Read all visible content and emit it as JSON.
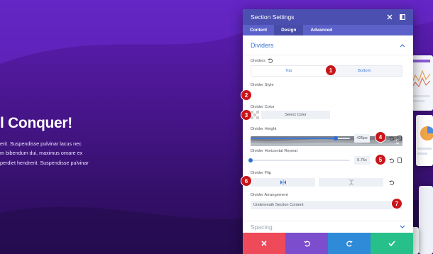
{
  "hero": {
    "title": "l Conquer!",
    "lines": [
      "erit. Suspendisse pulvinar lacus nec",
      "m bibendum dui, maximus ornare ex",
      "perdiet hendrerit. Suspendisse pulvinar"
    ]
  },
  "modal": {
    "title": "Section Settings",
    "tabs": [
      "Content",
      "Design",
      "Advanced"
    ],
    "active_tab": "Design",
    "section_title": "Dividers",
    "dividers_label": "Dividers",
    "segments": [
      "Top",
      "Bottom"
    ],
    "style_label": "Divider Style",
    "color_label": "Divider Color",
    "select_color": "Select Color",
    "height_label": "Divider Height",
    "height_value": "425px",
    "height_fraction": 0.86,
    "repeat_label": "Divider Horizontal Repeat",
    "repeat_value": "0.75x",
    "repeat_fraction": 0.0,
    "flip_label": "Divider Flip",
    "arrangement_label": "Divider Arrangement",
    "arrangement_value": "Underneath Section Content",
    "spacing_label": "Spacing"
  },
  "annotations": [
    "1",
    "2",
    "3",
    "4",
    "5",
    "6",
    "7"
  ],
  "colors": {
    "header": "#4a4fb0",
    "tabs": "#5b61c9",
    "accent": "#3e79d8",
    "cancel": "#ee4a5a",
    "undo": "#7c4dcc",
    "redo": "#2f8ad8",
    "save": "#27c08a",
    "badge": "#c9161b"
  }
}
